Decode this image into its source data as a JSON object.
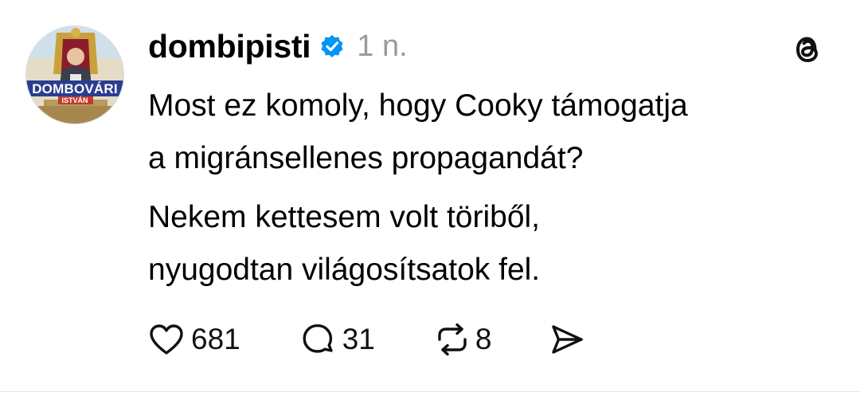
{
  "post": {
    "username": "dombipisti",
    "timestamp": "1 n.",
    "verified": true,
    "avatar": {
      "logo_text": "DOMBOVÁRI",
      "sub_text": "ISTVÁN"
    },
    "paragraphs": [
      {
        "lines": [
          "Most ez komoly, hogy Cooky támogatja",
          "a migránsellenes propagandát?"
        ]
      },
      {
        "lines": [
          "Nekem kettesem volt töriből,",
          "nyugodtan világosítsatok fel."
        ]
      }
    ],
    "stats": {
      "likes": "681",
      "replies": "31",
      "reposts": "8"
    }
  },
  "colors": {
    "text": "#000000",
    "muted": "#9a9a9a",
    "verified": "#0095f6",
    "divider": "#e3e3e3"
  },
  "icons": {
    "like": "heart-icon",
    "reply": "speech-bubble-icon",
    "repost": "repost-icon",
    "share": "send-icon",
    "brand": "threads-logo-icon",
    "badge": "verified-badge-icon"
  }
}
